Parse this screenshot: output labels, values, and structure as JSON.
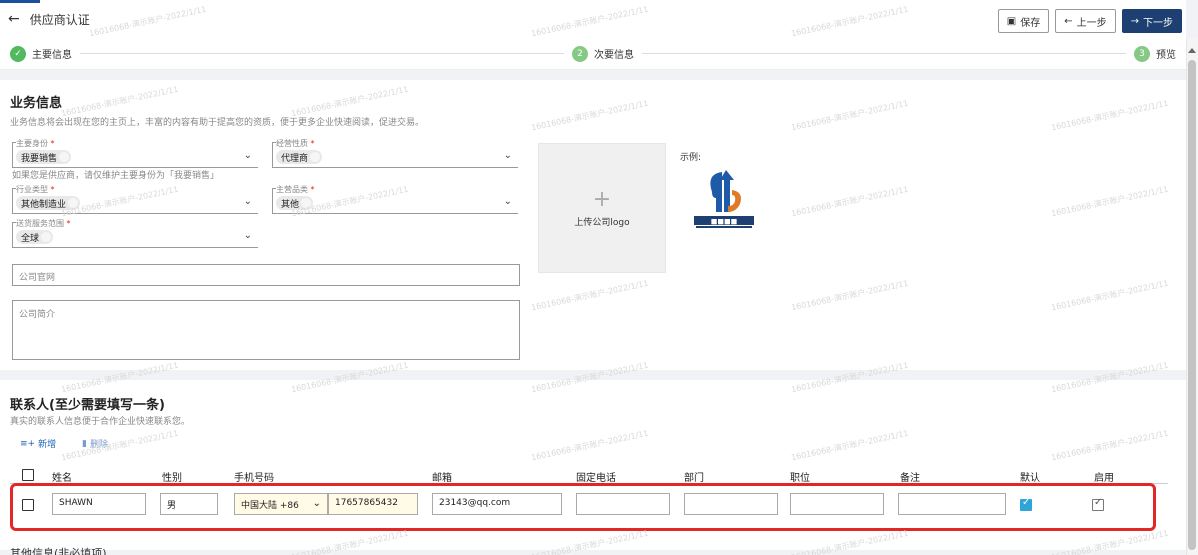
{
  "header": {
    "back_icon": "←",
    "title": "供应商认证",
    "save_label": "保存",
    "prev_label": "上一步",
    "next_label": "下一步",
    "accent_color": "#1e3f72"
  },
  "stepper": {
    "steps": [
      {
        "num": "✓",
        "label": "主要信息"
      },
      {
        "num": "2",
        "label": "次要信息"
      },
      {
        "num": "3",
        "label": "预览"
      }
    ]
  },
  "business": {
    "title": "业务信息",
    "desc": "业务信息将会出现在您的主页上，丰富的内容有助于提高您的资质，便于更多企业快速阅读，促进交易。",
    "fields": {
      "main_identity": {
        "label": "主要身份",
        "value": "我要销售"
      },
      "business_nature": {
        "label": "经营性质",
        "value": "代理商"
      },
      "industry_type": {
        "label": "行业类型",
        "value": "其他制造业"
      },
      "main_products": {
        "label": "主营品类",
        "value": "其他"
      },
      "service_scope": {
        "label": "送货服务范围",
        "value": "全球"
      }
    },
    "hint": "如果您是供应商，请仅维护主要身份为「我要销售」",
    "website_placeholder": "公司官网",
    "intro_placeholder": "公司简介",
    "upload_plus": "+",
    "upload_label": "上传公司logo",
    "example_label": "示例:"
  },
  "contacts": {
    "title": "联系人(至少需要填写一条)",
    "desc": "真实的联系人信息便于合作企业快速联系您。",
    "add_label": "新增",
    "delete_label": "删除",
    "columns": [
      "姓名",
      "性别",
      "手机号码",
      "邮箱",
      "固定电话",
      "部门",
      "职位",
      "备注",
      "默认",
      "启用"
    ],
    "row": {
      "name": "SHAWN",
      "gender": "男",
      "region": "中国大陆 +86",
      "phone": "17657865432",
      "email": "23143@qq.com",
      "landline": "",
      "department": "",
      "position": "",
      "note": "",
      "default_checked": true,
      "enabled_checked": true
    }
  },
  "other_section": {
    "title": "其他信息(非必填项)"
  },
  "watermark": "16016068-演示账户-2022/1/11",
  "colors": {
    "step_done": "#52b95e",
    "highlight_border": "#e32727",
    "link_blue": "#1e62b5",
    "check_blue": "#2fa4d6"
  }
}
